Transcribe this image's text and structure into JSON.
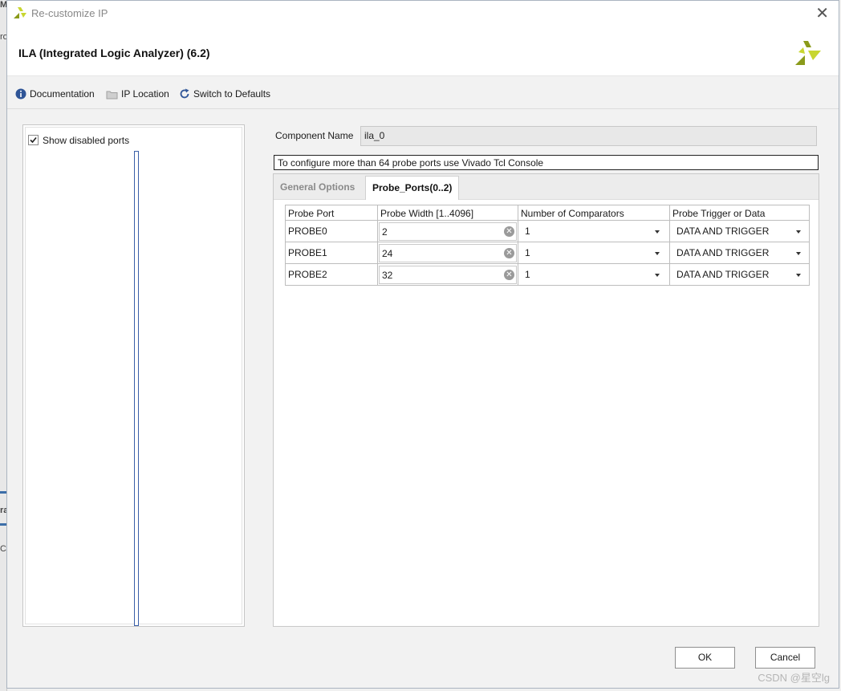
{
  "background_app": {
    "visible_fragments": [
      "M",
      "ro",
      "ra",
      "Co"
    ]
  },
  "window": {
    "title": "Re-customize IP"
  },
  "header": {
    "ip_title": "ILA (Integrated Logic Analyzer) (6.2)"
  },
  "toolbar": {
    "documentation": "Documentation",
    "ip_location": "IP Location",
    "switch_to_defaults": "Switch to Defaults"
  },
  "left_pane": {
    "show_disabled_ports": "Show disabled ports",
    "show_disabled_ports_checked": true
  },
  "component": {
    "label": "Component Name",
    "value": "ila_0"
  },
  "note": "To configure more than 64 probe ports use Vivado Tcl Console",
  "tabs": [
    {
      "label": "General Options",
      "active": false
    },
    {
      "label": "Probe_Ports(0..2)",
      "active": true
    }
  ],
  "probe_table": {
    "headers": [
      "Probe Port",
      "Probe Width [1..4096]",
      "Number of Comparators",
      "Probe Trigger or Data"
    ],
    "rows": [
      {
        "port": "PROBE0",
        "width": "2",
        "comparators": "1",
        "trigger": "DATA AND TRIGGER"
      },
      {
        "port": "PROBE1",
        "width": "24",
        "comparators": "1",
        "trigger": "DATA AND TRIGGER"
      },
      {
        "port": "PROBE2",
        "width": "32",
        "comparators": "1",
        "trigger": "DATA AND TRIGGER"
      }
    ]
  },
  "buttons": {
    "ok": "OK",
    "cancel": "Cancel"
  },
  "watermark": "CSDN @星空lg",
  "colors": {
    "accent_blue": "#3a5fa8",
    "logo_olive": "#8a9a1a",
    "logo_lime": "#c8d630"
  }
}
